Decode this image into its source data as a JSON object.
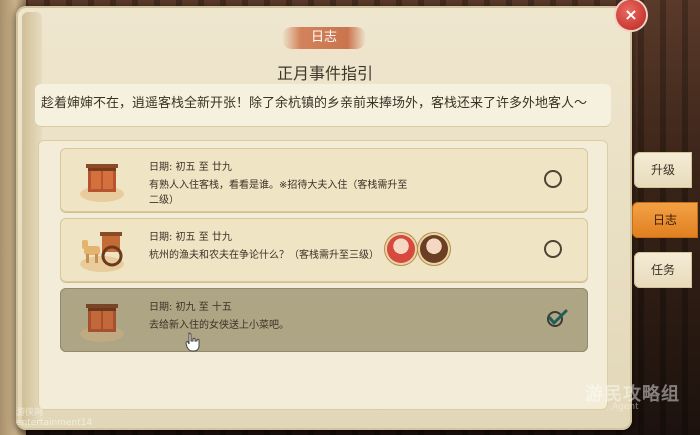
{
  "header": {
    "tab_title": "日志",
    "subtitle": "正月事件指引"
  },
  "intro": "趁着婶婶不在，逍遥客栈全新开张！除了余杭镇的乡亲前来捧场外，客栈还来了许多外地客人～",
  "events": [
    {
      "date": "日期: 初五 至 廿九",
      "desc": "有熟人入住客栈，看看是谁。※招待大夫入住（客栈需升至二级）",
      "status": "open",
      "icon": "inn-door-icon"
    },
    {
      "date": "日期: 初五 至 廿九",
      "desc": "杭州的渔夫和农夫在争论什么？（客栈需升至三级）",
      "status": "open",
      "icon": "horse-cart-icon"
    },
    {
      "date": "日期: 初九 至 十五",
      "desc": "去给新入住的女侠送上小菜吧。",
      "status": "done",
      "icon": "inn-door-icon"
    }
  ],
  "side_tabs": [
    {
      "label": "升级",
      "active": false
    },
    {
      "label": "日志",
      "active": true
    },
    {
      "label": "任务",
      "active": false
    }
  ],
  "close_label": "×",
  "watermarks": {
    "left_line1": "游侠网",
    "left_line2": "entertainment14",
    "right_main": "游民攻略组",
    "right_sub": "Agent"
  },
  "colors": {
    "accent": "#e8881f",
    "close": "#d4473f",
    "title_tag": "#cc7a52"
  }
}
